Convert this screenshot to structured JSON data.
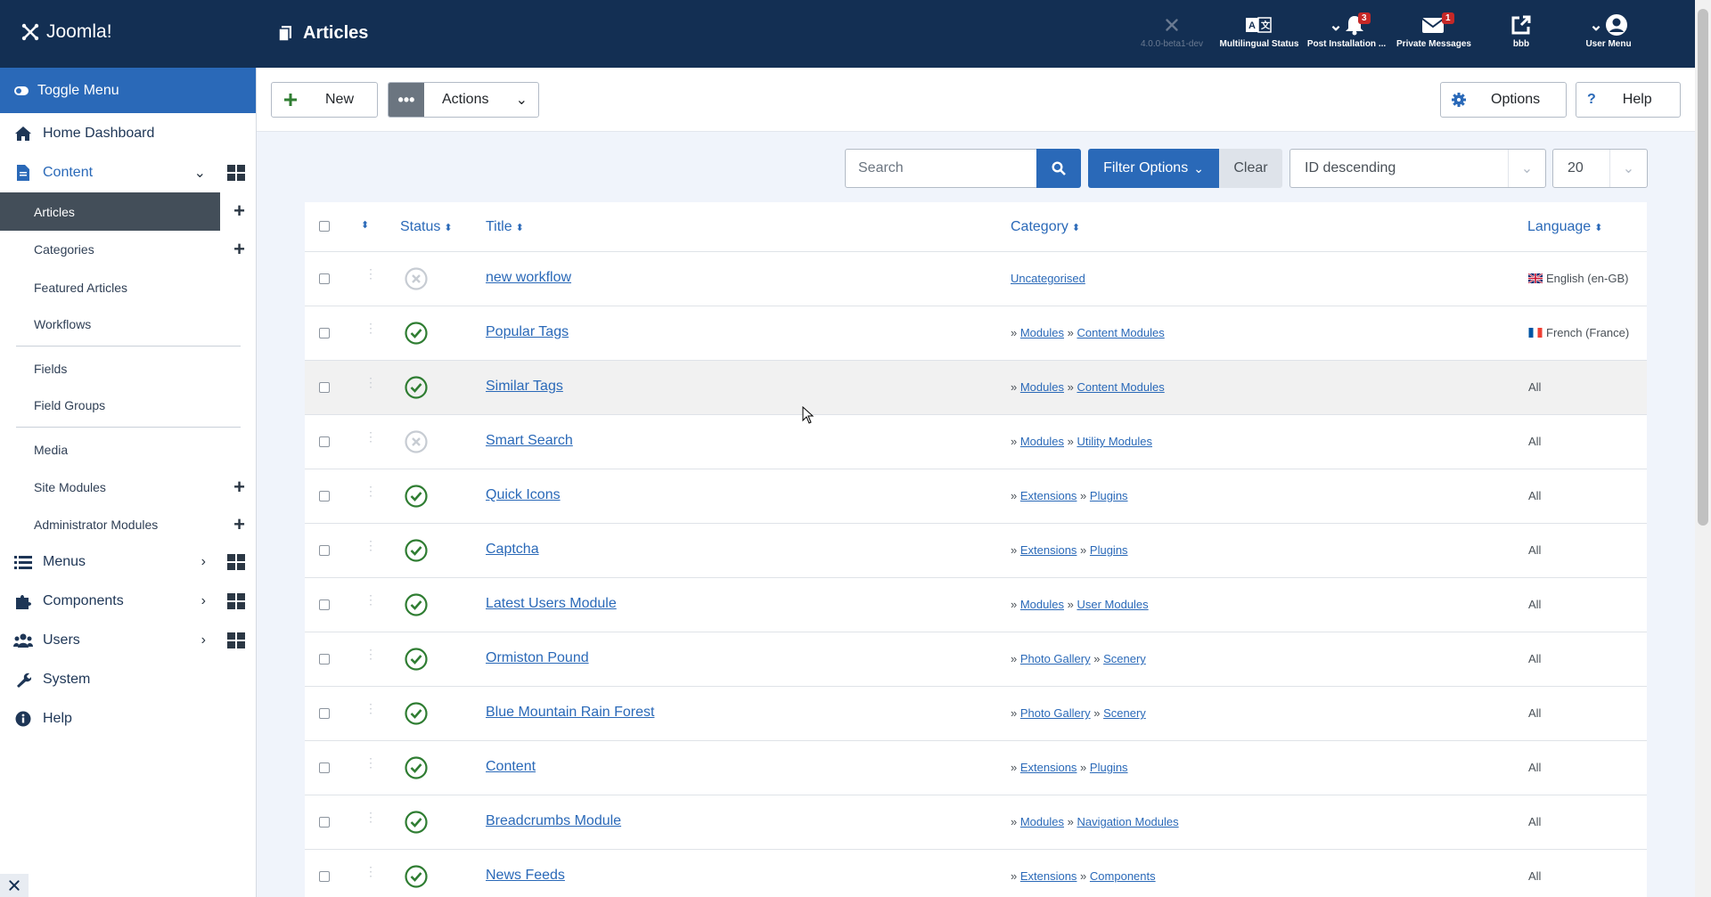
{
  "header": {
    "brand": "Joomla!",
    "page_title": "Articles",
    "items": [
      {
        "label": "4.0.0-beta1-dev",
        "icon": "joomla-icon",
        "badge": ""
      },
      {
        "label": "Multilingual Status",
        "icon": "language-icon",
        "badge": ""
      },
      {
        "label": "Post Installation ...",
        "icon": "bell-icon",
        "badge": "3"
      },
      {
        "label": "Private Messages",
        "icon": "envelope-icon",
        "badge": "1"
      },
      {
        "label": "bbb",
        "icon": "external-link-icon",
        "badge": ""
      },
      {
        "label": "User Menu",
        "icon": "user-icon",
        "badge": ""
      }
    ]
  },
  "sidebar": {
    "toggle": "Toggle Menu",
    "home": "Home Dashboard",
    "content": "Content",
    "sub_items": [
      "Articles",
      "Categories",
      "Featured Articles",
      "Workflows",
      "Fields",
      "Field Groups",
      "Media",
      "Site Modules",
      "Administrator Modules"
    ],
    "menus": "Menus",
    "components": "Components",
    "users": "Users",
    "system": "System",
    "help": "Help"
  },
  "toolbar": {
    "new_label": "New",
    "actions_label": "Actions",
    "options_label": "Options",
    "help_label": "Help"
  },
  "filters": {
    "search_placeholder": "Search",
    "filter_options": "Filter Options",
    "clear": "Clear",
    "ordering": "ID descending",
    "limit": "20"
  },
  "table": {
    "columns": {
      "status": "Status",
      "title": "Title",
      "category": "Category",
      "language": "Language"
    },
    "rows": [
      {
        "status": "unpublished",
        "title": "new workflow",
        "cat_parent": "",
        "cat": "Uncategorised",
        "language": "English (en-GB)",
        "flag": "gb"
      },
      {
        "status": "published",
        "title": "Popular Tags",
        "cat_parent": "Modules",
        "cat": "Content Modules",
        "language": "French (France)",
        "flag": "fr"
      },
      {
        "status": "published",
        "title": "Similar Tags",
        "cat_parent": "Modules",
        "cat": "Content Modules",
        "language": "All",
        "flag": ""
      },
      {
        "status": "unpublished",
        "title": "Smart Search",
        "cat_parent": "Modules",
        "cat": "Utility Modules",
        "language": "All",
        "flag": ""
      },
      {
        "status": "published",
        "title": "Quick Icons",
        "cat_parent": "Extensions",
        "cat": "Plugins",
        "language": "All",
        "flag": ""
      },
      {
        "status": "published",
        "title": "Captcha",
        "cat_parent": "Extensions",
        "cat": "Plugins",
        "language": "All",
        "flag": ""
      },
      {
        "status": "published",
        "title": "Latest Users Module",
        "cat_parent": "Modules",
        "cat": "User Modules",
        "language": "All",
        "flag": ""
      },
      {
        "status": "published",
        "title": "Ormiston Pound",
        "cat_parent": "Photo Gallery",
        "cat": "Scenery",
        "language": "All",
        "flag": ""
      },
      {
        "status": "published",
        "title": "Blue Mountain Rain Forest",
        "cat_parent": "Photo Gallery",
        "cat": "Scenery",
        "language": "All",
        "flag": ""
      },
      {
        "status": "published",
        "title": "Content",
        "cat_parent": "Extensions",
        "cat": "Plugins",
        "language": "All",
        "flag": ""
      },
      {
        "status": "published",
        "title": "Breadcrumbs Module",
        "cat_parent": "Modules",
        "cat": "Navigation Modules",
        "language": "All",
        "flag": ""
      },
      {
        "status": "published",
        "title": "News Feeds",
        "cat_parent": "Extensions",
        "cat": "Components",
        "language": "All",
        "flag": ""
      }
    ]
  },
  "colors": {
    "header": "#132f53",
    "accent": "#2a69b8",
    "published": "#2f7d32",
    "unpublished": "#c7ccd3"
  }
}
